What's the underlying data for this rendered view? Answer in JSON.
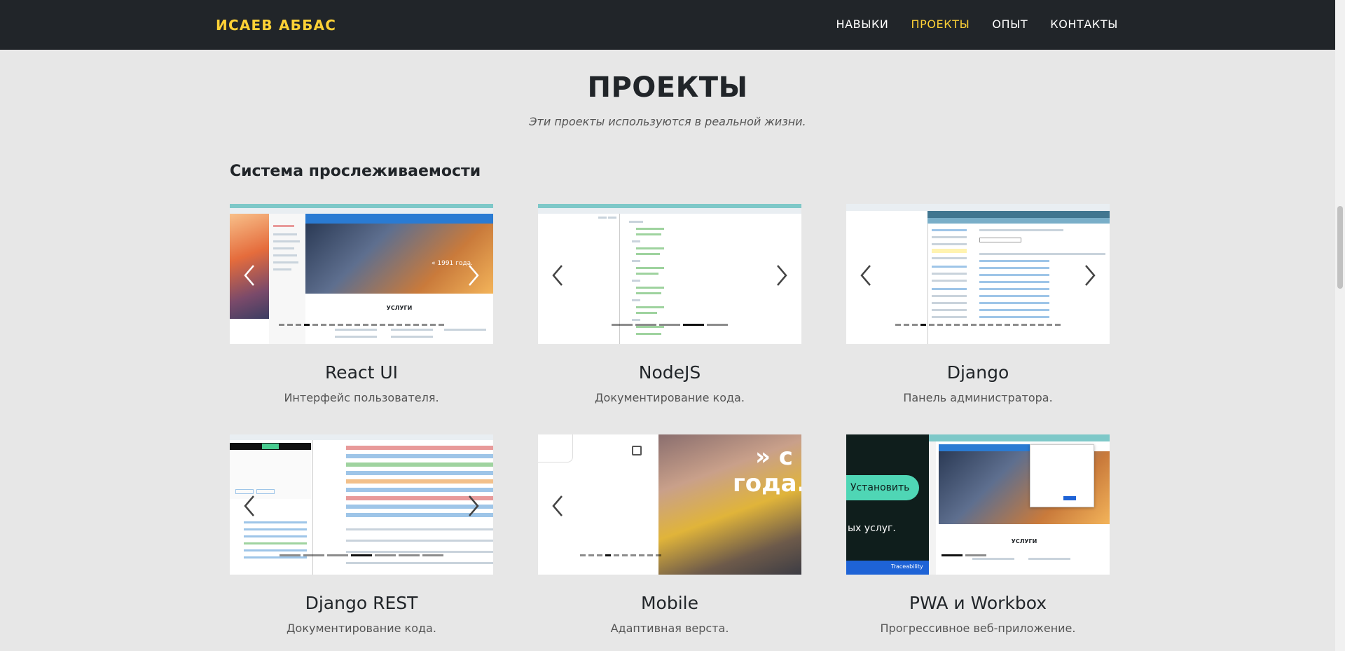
{
  "navbar": {
    "brand": "ИСАЕВ АББАС",
    "links": [
      {
        "label": "НАВЫКИ",
        "active": false
      },
      {
        "label": "ПРОЕКТЫ",
        "active": true
      },
      {
        "label": "ОПЫТ",
        "active": false
      },
      {
        "label": "КОНТАКТЫ",
        "active": false
      }
    ]
  },
  "section": {
    "title": "ПРОЕКТЫ",
    "subtitle": "Эти проекты используются в реальной жизни.",
    "group_title": "Система прослеживаемости"
  },
  "projects": [
    {
      "title": "React UI",
      "description": "Интерфейс пользователя.",
      "mock_heading": "УСЛУГИ",
      "mock_caption": "« 1991 года."
    },
    {
      "title": "NodeJS",
      "description": "Документирование кода."
    },
    {
      "title": "Django",
      "description": "Панель администратора."
    },
    {
      "title": "Django REST",
      "description": "Документирование кода."
    },
    {
      "title": "Mobile",
      "description": "Адаптивная верста.",
      "mock_caption_1": "» с",
      "mock_caption_2": "года."
    },
    {
      "title": "PWA и Workbox",
      "description": "Прогрессивное веб-приложение.",
      "mock_button": "Установить",
      "mock_footer": "Traceability",
      "mock_subtitle": "ых услуг.",
      "mock_heading": "УСЛУГИ"
    }
  ],
  "colors": {
    "navbar_bg": "#212529",
    "accent": "#fed136",
    "page_bg": "#e7e7e7"
  }
}
